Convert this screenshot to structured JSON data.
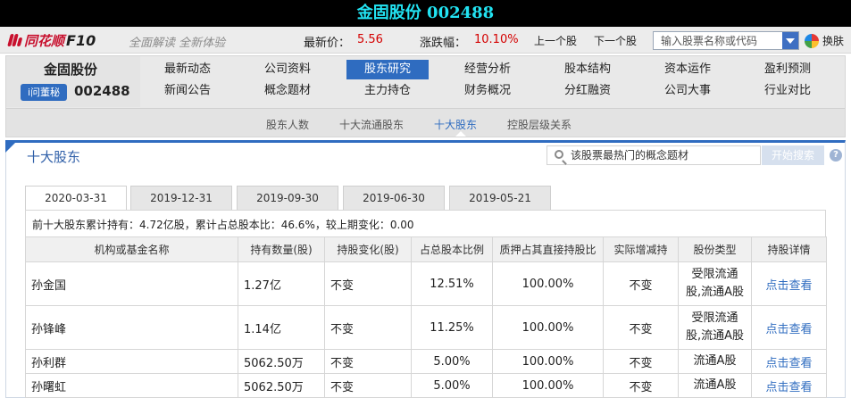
{
  "window": {
    "title": "金固股份 002488"
  },
  "header": {
    "logo_text": "同花顺",
    "logo_f10": "F10",
    "slogan": "全面解读 全新体验",
    "price_label": "最新价：",
    "price_value": "5.56",
    "change_label": "涨跌幅：",
    "change_value": "10.10%",
    "prev_stock": "上一个股",
    "next_stock": "下一个股",
    "search_placeholder": "输入股票名称或代码",
    "skin_label": "换肤"
  },
  "stock": {
    "name": "金固股份",
    "dongmi_badge": "i问董秘",
    "code": "002488"
  },
  "nav": {
    "row1": [
      "最新动态",
      "公司资料",
      "股东研究",
      "经营分析",
      "股本结构",
      "资本运作",
      "盈利预测"
    ],
    "row2": [
      "新闻公告",
      "概念题材",
      "主力持仓",
      "财务概况",
      "分红融资",
      "公司大事",
      "行业对比"
    ],
    "active": "股东研究"
  },
  "subnav": {
    "items": [
      "股东人数",
      "十大流通股东",
      "十大股东",
      "控股层级关系"
    ],
    "active": "十大股东"
  },
  "panel": {
    "title": "十大股东",
    "concept_search_placeholder": "该股票最热门的概念题材",
    "search_button": "开始搜索",
    "help": "?"
  },
  "date_tabs": [
    "2020-03-31",
    "2019-12-31",
    "2019-09-30",
    "2019-06-30",
    "2019-05-21"
  ],
  "active_date": "2020-03-31",
  "summary": "前十大股东累计持有：4.72亿股，累计占总股本比：46.6%，较上期变化：0.00",
  "table": {
    "headers": [
      "机构或基金名称",
      "持有数量(股)",
      "持股变化(股)",
      "占总股本比例",
      "质押占其直接持股比",
      "实际增减持",
      "股份类型",
      "持股详情"
    ],
    "rows": [
      {
        "name": "孙金国",
        "qty": "1.27亿",
        "change": "不变",
        "ratio": "12.51%",
        "pledge": "100.00%",
        "actual": "不变",
        "type": "受限流通股,流通A股",
        "detail": "点击查看"
      },
      {
        "name": "孙锋峰",
        "qty": "1.14亿",
        "change": "不变",
        "ratio": "11.25%",
        "pledge": "100.00%",
        "actual": "不变",
        "type": "受限流通股,流通A股",
        "detail": "点击查看"
      },
      {
        "name": "孙利群",
        "qty": "5062.50万",
        "change": "不变",
        "ratio": "5.00%",
        "pledge": "100.00%",
        "actual": "不变",
        "type": "流通A股",
        "detail": "点击查看"
      },
      {
        "name": "孙曙虹",
        "qty": "5062.50万",
        "change": "不变",
        "ratio": "5.00%",
        "pledge": "100.00%",
        "actual": "不变",
        "type": "流通A股",
        "detail": "点击查看"
      }
    ]
  },
  "colors": {
    "title_text": "#22e3f2",
    "accent": "#2f6cc0",
    "price_up": "#d40000",
    "brand": "#c8102e"
  }
}
